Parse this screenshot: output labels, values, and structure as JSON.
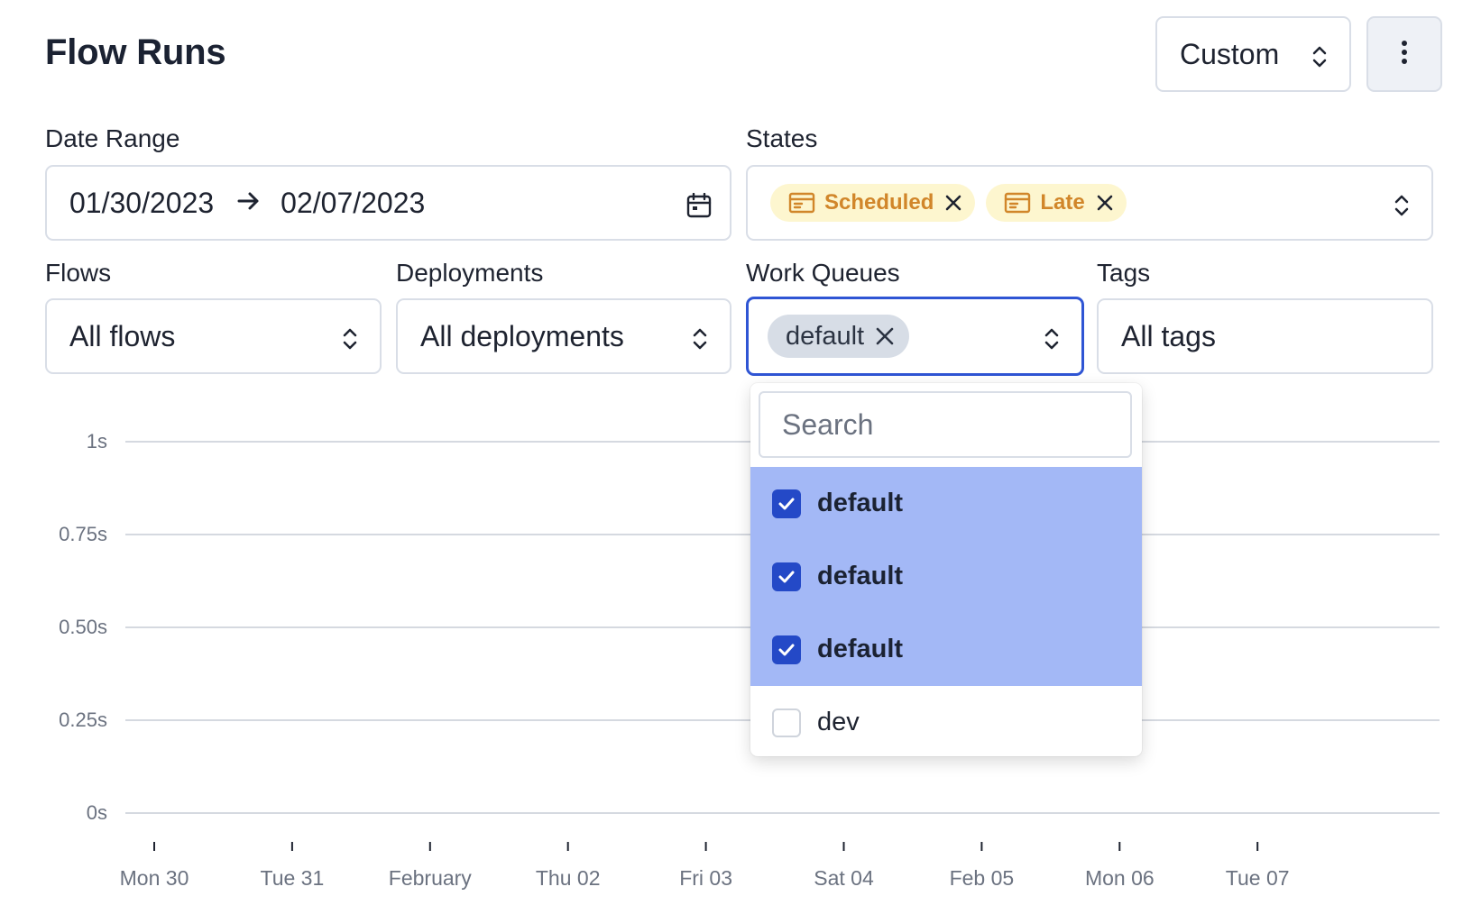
{
  "page": {
    "title": "Flow Runs"
  },
  "header": {
    "custom_label": "Custom"
  },
  "filters": {
    "date_range": {
      "label": "Date Range",
      "start": "01/30/2023",
      "end": "02/07/2023"
    },
    "states": {
      "label": "States",
      "tags": [
        {
          "label": "Scheduled",
          "color": "#d1862a",
          "bg": "#fdf6cf"
        },
        {
          "label": "Late",
          "color": "#d1862a",
          "bg": "#fdf6cf"
        }
      ]
    },
    "flows": {
      "label": "Flows",
      "value": "All flows"
    },
    "deployments": {
      "label": "Deployments",
      "value": "All deployments"
    },
    "work_queues": {
      "label": "Work Queues",
      "tag": "default"
    },
    "tags": {
      "label": "Tags",
      "value": "All tags"
    }
  },
  "dropdown": {
    "search_placeholder": "Search",
    "options": [
      {
        "label": "default",
        "checked": true
      },
      {
        "label": "default",
        "checked": true
      },
      {
        "label": "default",
        "checked": true
      },
      {
        "label": "dev",
        "checked": false
      }
    ]
  },
  "colors": {
    "accent": "#2f55d4",
    "selected_bg": "#a3b8f6",
    "checkbox": "#2449c7"
  },
  "chart_data": {
    "type": "bar",
    "y_ticks": [
      "1s",
      "0.75s",
      "0.50s",
      "0.25s",
      "0s"
    ],
    "x_ticks": [
      "Mon 30",
      "Tue 31",
      "February",
      "Thu 02",
      "Fri 03",
      "Sat 04",
      "Feb 05",
      "Mon 06",
      "Tue 07"
    ],
    "ylim": [
      0,
      1
    ],
    "values": [],
    "grid": true
  }
}
